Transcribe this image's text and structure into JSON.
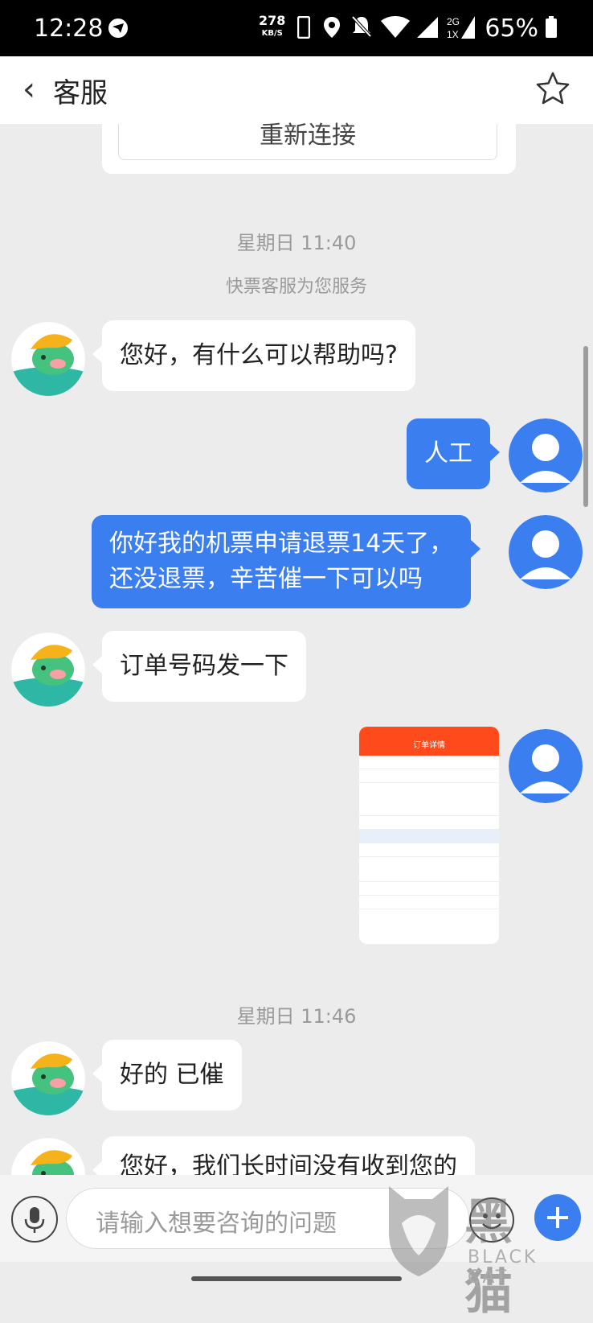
{
  "status_bar": {
    "time": "12:28",
    "net_speed_value": "278",
    "net_speed_unit": "KB/S",
    "battery": "65%"
  },
  "header": {
    "back_label": "‹",
    "title": "客服"
  },
  "top_card": {
    "reconnect_label": "重新连接"
  },
  "messages": [
    {
      "type": "timestamp",
      "text": "星期日 11:40"
    },
    {
      "type": "system",
      "text": "快票客服为您服务"
    },
    {
      "type": "incoming",
      "text": "您好，有什么可以帮助吗?"
    },
    {
      "type": "outgoing",
      "text": "人工"
    },
    {
      "type": "outgoing",
      "text_line1": "你好我的机票申请退票14天了，",
      "text_line2": "还没退票，辛苦催一下可以吗"
    },
    {
      "type": "incoming",
      "text": "订单号码发一下"
    },
    {
      "type": "outgoing_image",
      "caption": "订单详情"
    },
    {
      "type": "timestamp",
      "text": "星期日 11:46"
    },
    {
      "type": "incoming",
      "text": "好的 已催"
    },
    {
      "type": "incoming",
      "text": "您好，我们长时间没有收到您的"
    }
  ],
  "input_bar": {
    "placeholder": "请输入想要咨询的问题"
  },
  "watermark": {
    "brand": "黑猫",
    "sub": "BLACK CAT"
  },
  "colors": {
    "accent": "#3a7ef0",
    "header_bg": "#ffffff",
    "chat_bg": "#ececec"
  }
}
